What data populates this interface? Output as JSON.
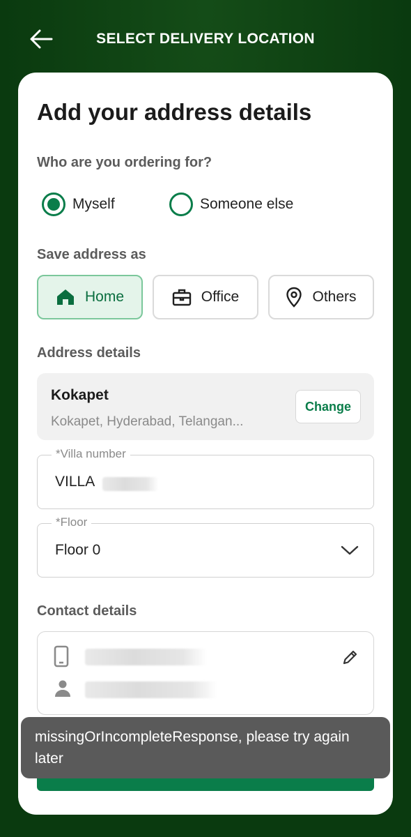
{
  "header": {
    "title": "SELECT DELIVERY LOCATION"
  },
  "card": {
    "heading": "Add your address details",
    "ordering_for": {
      "label": "Who are you ordering for?",
      "options": [
        "Myself",
        "Someone else"
      ],
      "selected": "Myself"
    },
    "save_as": {
      "label": "Save address as",
      "options": [
        "Home",
        "Office",
        "Others"
      ],
      "selected": "Home"
    },
    "address": {
      "label": "Address details",
      "location_name": "Kokapet",
      "location_address": "Kokapet, Hyderabad, Telangan...",
      "change_label": "Change",
      "villa_label": "*Villa number",
      "villa_value": "VILLA",
      "floor_label": "*Floor",
      "floor_value": "Floor 0"
    },
    "contact": {
      "label": "Contact details"
    }
  },
  "toast": {
    "message": "missingOrIncompleteResponse, please try again later"
  },
  "colors": {
    "accent": "#0a7d4a",
    "background": "#0a3a0f",
    "chip_active_bg": "#e4f4ea",
    "toast_bg": "#5a5a5a"
  }
}
